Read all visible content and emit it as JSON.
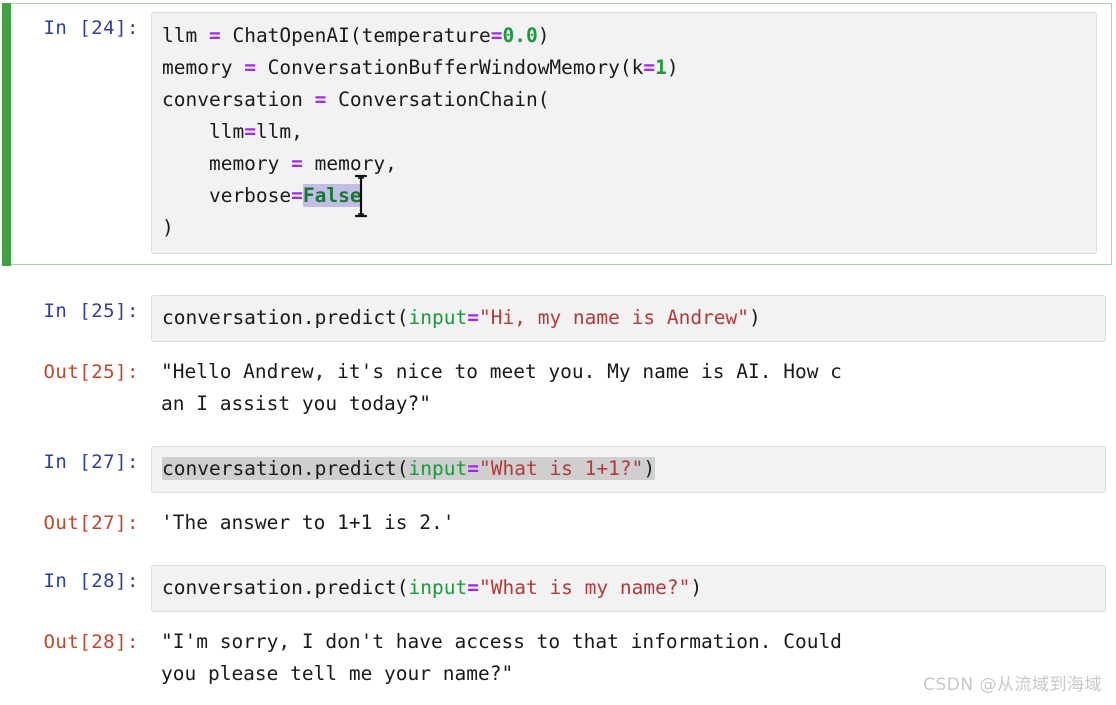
{
  "notebook": {
    "watermark": "CSDN @从流域到海域",
    "colors": {
      "prompt_in": "#303f9f",
      "prompt_out": "#c0452a",
      "edit_bar_green": "#42a045",
      "cell_border_green": "#a7d4a8",
      "input_background": "#f2f2f2",
      "operator_purple": "#a626f7",
      "string_red": "#b33a3a",
      "keyword_green": "#1a9a3c",
      "selection_lavender": "#c3bce8",
      "selection_gray": "#cfcfcf"
    },
    "cells": [
      {
        "id": "cell-24",
        "type": "code",
        "selected": true,
        "edit_mode": true,
        "prompt": "In [24]:",
        "source_lines": [
          "llm = ChatOpenAI(temperature=0.0)",
          "memory = ConversationBufferWindowMemory(k=1)",
          "conversation = ConversationChain(",
          "    llm=llm,",
          "    memory = memory,",
          "    verbose=False",
          ")"
        ],
        "l1_a": "llm ",
        "l1_op": "=",
        "l1_b": " ChatOpenAI(temperature",
        "l1_op2": "=",
        "l1_num": "0.0",
        "l1_c": ")",
        "l2_a": "memory ",
        "l2_op": "=",
        "l2_b": " ConversationBufferWindowMemory(k",
        "l2_op2": "=",
        "l2_num": "1",
        "l2_c": ")",
        "l3_a": "conversation ",
        "l3_op": "=",
        "l3_b": " ConversationChain(",
        "l4_a": "    llm",
        "l4_op": "=",
        "l4_b": "llm,",
        "l5_a": "    memory ",
        "l5_op": "=",
        "l5_b": " memory,",
        "l6_a": "    verbose",
        "l6_op": "=",
        "l6_bool": "False",
        "l7_a": ")",
        "cursor": {
          "visible": true,
          "glyph": "text-ibeam",
          "over_token": "False"
        }
      },
      {
        "id": "cell-25",
        "type": "code",
        "selected": false,
        "prompt": "In [25]:",
        "source_lines": [
          "conversation.predict(input=\"Hi, my name is Andrew\")"
        ],
        "c_a": "conversation.predict(",
        "c_kw": "input",
        "c_op": "=",
        "c_str": "\"Hi, my name is Andrew\"",
        "c_b": ")"
      },
      {
        "id": "out-25",
        "type": "output",
        "prompt": "Out[25]:",
        "text_line_1": "\"Hello Andrew, it's nice to meet you. My name is AI. How c",
        "text_line_2": "an I assist you today?\"",
        "full_text": "\"Hello Andrew, it's nice to meet you. My name is AI. How can I assist you today?\""
      },
      {
        "id": "cell-27",
        "type": "code",
        "selected": false,
        "text_selected": true,
        "prompt": "In [27]:",
        "source_lines": [
          "conversation.predict(input=\"What is 1+1?\")"
        ],
        "c_a": "conversation.predict(",
        "c_kw": "input",
        "c_op": "=",
        "c_str": "\"What is 1+1?\"",
        "c_b": ")"
      },
      {
        "id": "out-27",
        "type": "output",
        "prompt": "Out[27]:",
        "text_line_1": "'The answer to 1+1 is 2.'",
        "full_text": "'The answer to 1+1 is 2.'"
      },
      {
        "id": "cell-28",
        "type": "code",
        "selected": false,
        "prompt": "In [28]:",
        "source_lines": [
          "conversation.predict(input=\"What is my name?\")"
        ],
        "c_a": "conversation.predict(",
        "c_kw": "input",
        "c_op": "=",
        "c_str": "\"What is my name?\"",
        "c_b": ")"
      },
      {
        "id": "out-28",
        "type": "output",
        "prompt": "Out[28]:",
        "text_line_1": "\"I'm sorry, I don't have access to that information. Could",
        "text_line_2": "you please tell me your name?\"",
        "full_text": "\"I'm sorry, I don't have access to that information. Could you please tell me your name?\""
      }
    ]
  }
}
